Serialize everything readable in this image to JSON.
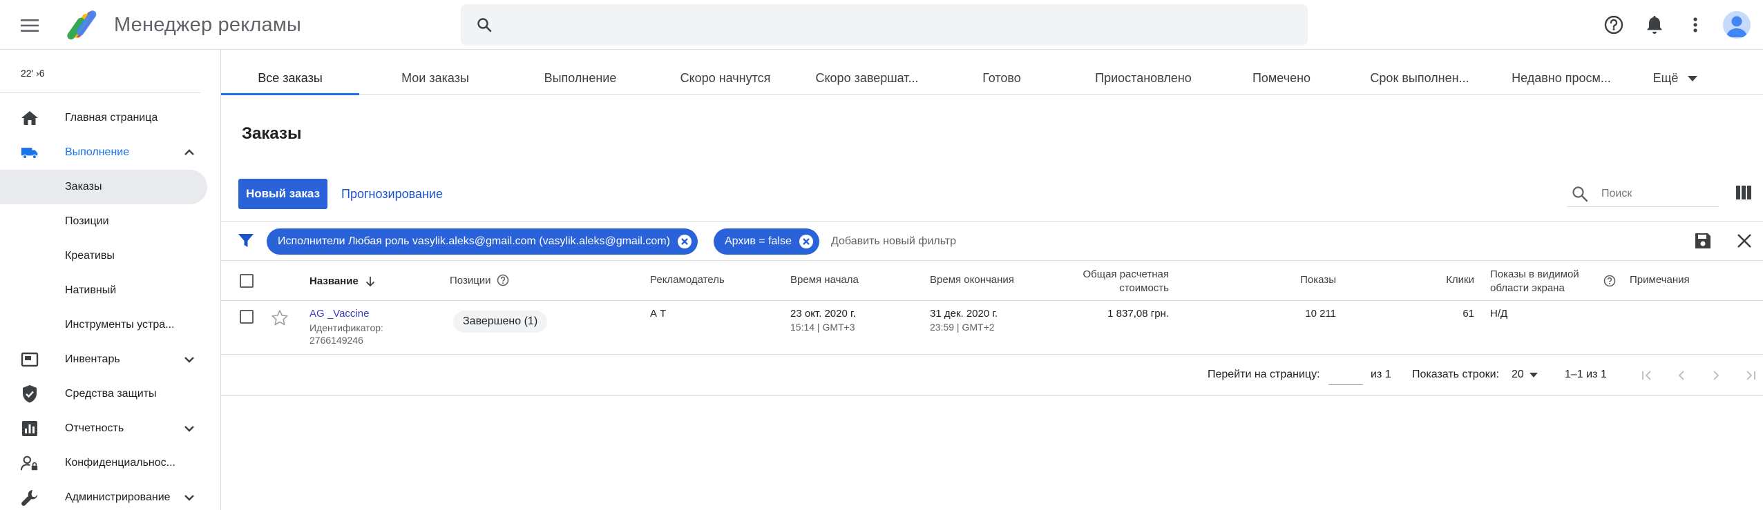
{
  "colors": {
    "accent": "#1a73e8",
    "primary_button": "#2962d9",
    "link": "#3a3ec4",
    "selected_nav_bg": "#e8eaed",
    "border": "#dadce0"
  },
  "header": {
    "app_title": "Менеджер рекламы",
    "search_placeholder": "",
    "icons": [
      "menu-icon",
      "help-icon",
      "notifications-icon",
      "more-vert-icon",
      "account-avatar"
    ]
  },
  "sidebar": {
    "account_id": "22'          ›6",
    "items": [
      {
        "label": "Главная страница",
        "icon": "home-icon"
      },
      {
        "label": "Выполнение",
        "icon": "truck-icon",
        "expanded": true
      },
      {
        "label": "Заказы",
        "selected": true
      },
      {
        "label": "Позиции"
      },
      {
        "label": "Креативы"
      },
      {
        "label": "Нативный"
      },
      {
        "label": "Инструменты устра..."
      },
      {
        "label": "Инвентарь",
        "icon": "inventory-icon",
        "expanded": false
      },
      {
        "label": "Средства защиты",
        "icon": "shield-icon"
      },
      {
        "label": "Отчетность",
        "icon": "reporting-icon",
        "expanded": false
      },
      {
        "label": "Конфиденциальнос...",
        "icon": "privacy-icon"
      },
      {
        "label": "Администрирование",
        "icon": "wrench-icon",
        "expanded": false
      }
    ]
  },
  "tabs": [
    {
      "label": "Все заказы",
      "active": true
    },
    {
      "label": "Мои заказы"
    },
    {
      "label": "Выполнение"
    },
    {
      "label": "Скоро начнутся"
    },
    {
      "label": "Скоро завершат..."
    },
    {
      "label": "Готово"
    },
    {
      "label": "Приостановлено"
    },
    {
      "label": "Помечено"
    },
    {
      "label": "Срок выполнен..."
    },
    {
      "label": "Недавно просм..."
    },
    {
      "label": "Ещё"
    }
  ],
  "main": {
    "title": "Заказы",
    "new_order_label": "Новый заказ",
    "forecast_label": "Прогнозирование",
    "search_placeholder": "Поиск",
    "filters": [
      {
        "label": "Исполнители Любая роль vasylik.aleks@gmail.com (vasylik.aleks@gmail.com)"
      },
      {
        "label": "Архив = false"
      }
    ],
    "add_filter_label": "Добавить новый фильтр"
  },
  "table": {
    "headers": {
      "name": "Название",
      "positions": "Позиции",
      "advertiser": "Рекламодатель",
      "start": "Время начала",
      "end": "Время окончания",
      "cost_line1": "Общая расчетная",
      "cost_line2": "стоимость",
      "impressions": "Показы",
      "clicks": "Клики",
      "viewable_line1": "Показы в видимой",
      "viewable_line2": "области экрана",
      "notes": "Примечания"
    },
    "rows": [
      {
        "name": "AG        _Vaccine",
        "id_label": "Идентификатор:",
        "id_value": "2766149246",
        "positions": "Завершено (1)",
        "advertiser": "А          Т",
        "start_date": "23 окт. 2020 г.",
        "start_time": "15:14 | GMT+3",
        "end_date": "31 дек. 2020 г.",
        "end_time": "23:59 | GMT+2",
        "cost": "1 837,08 грн.",
        "impressions": "10 211",
        "clicks": "61",
        "viewable": "Н/Д",
        "notes": ""
      }
    ]
  },
  "pagination": {
    "goto_label": "Перейти на страницу:",
    "goto_value": "",
    "of_label": "из 1",
    "rows_label": "Показать строки:",
    "rows_value": "20",
    "range": "1–1 из 1"
  }
}
